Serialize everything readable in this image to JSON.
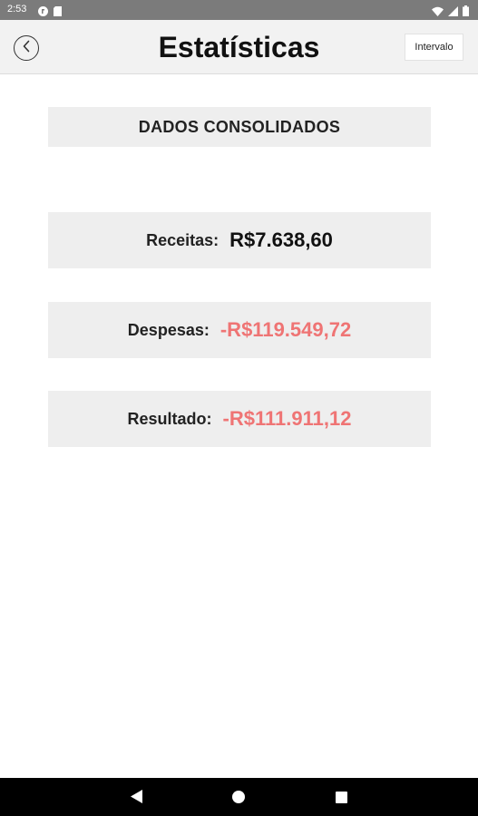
{
  "status_bar": {
    "time": "2:53",
    "left_icons": [
      "notification-app-icon",
      "sd-card-icon"
    ],
    "right_icons": [
      "wifi-icon",
      "cellular-signal-icon",
      "battery-icon"
    ]
  },
  "header": {
    "back_icon": "back-circle-icon",
    "title": "Estatísticas",
    "interval_label": "Intervalo"
  },
  "section": {
    "title": "DADOS CONSOLIDADOS"
  },
  "stats": [
    {
      "label": "Receitas:",
      "value": "R$7.638,60",
      "color": "#111111"
    },
    {
      "label": "Despesas:",
      "value": "-R$119.549,72",
      "color": "#ef7474"
    },
    {
      "label": "Resultado:",
      "value": "-R$111.911,12",
      "color": "#ef7474"
    }
  ],
  "nav_bar": {
    "icons": [
      "nav-back-icon",
      "nav-home-icon",
      "nav-recents-icon"
    ]
  }
}
